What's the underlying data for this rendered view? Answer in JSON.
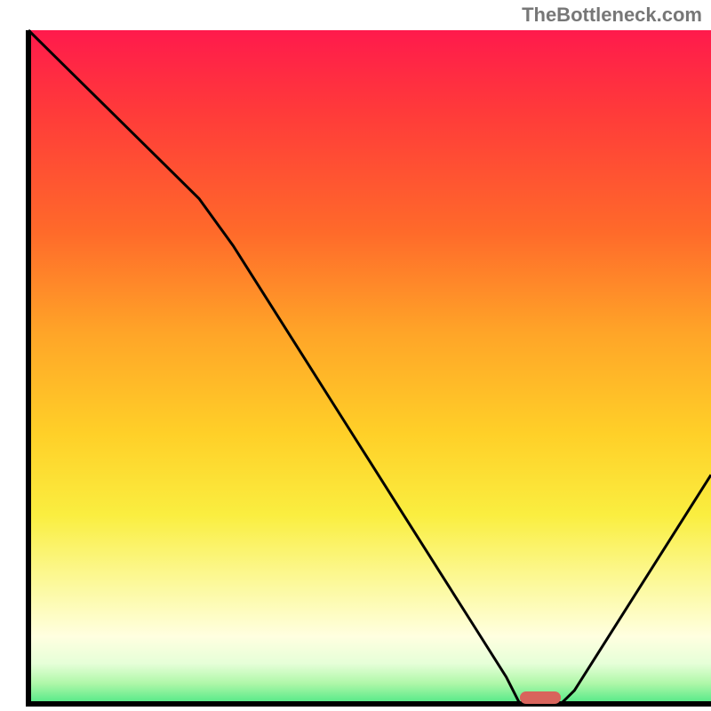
{
  "watermark": "TheBottleneck.com",
  "chart_data": {
    "type": "line",
    "x": [
      0.0,
      0.05,
      0.1,
      0.15,
      0.2,
      0.25,
      0.3,
      0.35,
      0.4,
      0.45,
      0.5,
      0.55,
      0.6,
      0.65,
      0.7,
      0.72,
      0.75,
      0.78,
      0.8,
      0.85,
      0.9,
      0.95,
      1.0
    ],
    "y": [
      1.0,
      0.95,
      0.9,
      0.85,
      0.8,
      0.75,
      0.68,
      0.6,
      0.52,
      0.44,
      0.36,
      0.28,
      0.2,
      0.12,
      0.04,
      0.0,
      0.0,
      0.0,
      0.02,
      0.1,
      0.18,
      0.26,
      0.34
    ],
    "trough_marker": {
      "x_start": 0.72,
      "x_end": 0.78,
      "color": "#d9645c"
    },
    "gradient_stops": [
      {
        "t": 0.0,
        "c": "#ff1a4c"
      },
      {
        "t": 0.12,
        "c": "#ff3a3a"
      },
      {
        "t": 0.3,
        "c": "#ff6a2a"
      },
      {
        "t": 0.45,
        "c": "#ffa528"
      },
      {
        "t": 0.6,
        "c": "#ffd028"
      },
      {
        "t": 0.72,
        "c": "#faee40"
      },
      {
        "t": 0.82,
        "c": "#fcf99a"
      },
      {
        "t": 0.9,
        "c": "#ffffe0"
      },
      {
        "t": 0.94,
        "c": "#e6ffd8"
      },
      {
        "t": 0.97,
        "c": "#aef7a8"
      },
      {
        "t": 1.0,
        "c": "#4fe886"
      }
    ],
    "xlabel": "",
    "ylabel": "",
    "xlim": [
      0,
      1
    ],
    "ylim": [
      0,
      1
    ],
    "title": ""
  }
}
